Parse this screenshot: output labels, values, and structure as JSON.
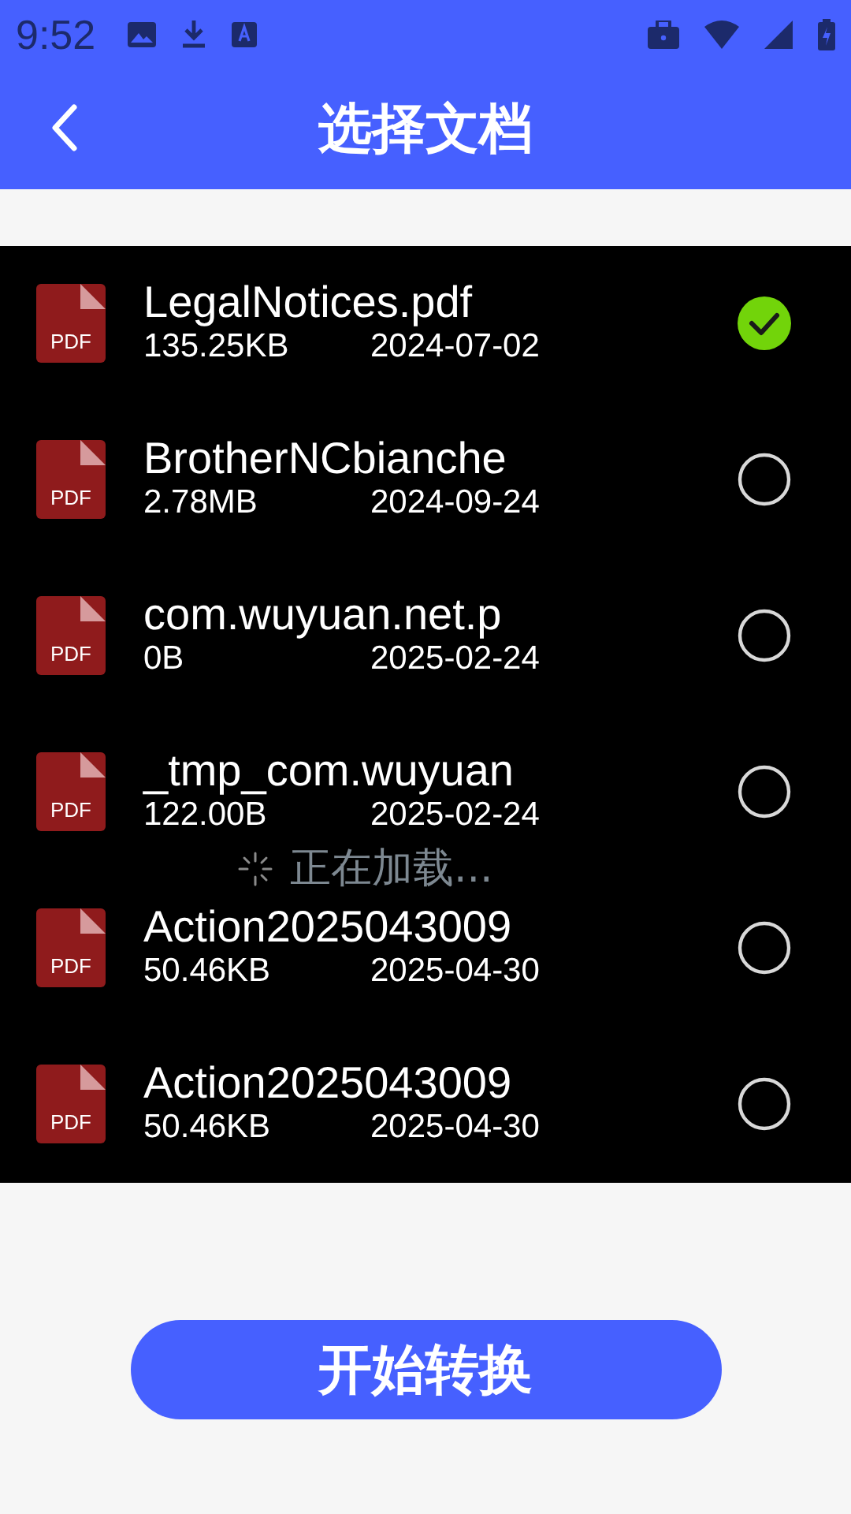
{
  "status_bar": {
    "time": "9:52"
  },
  "header": {
    "title": "选择文档"
  },
  "files": [
    {
      "name": "LegalNotices.pdf",
      "size": "135.25KB",
      "date": "2024-07-02",
      "type_label": "PDF",
      "selected": true
    },
    {
      "name": "BrotherNCbianche",
      "size": "2.78MB",
      "date": "2024-09-24",
      "type_label": "PDF",
      "selected": false
    },
    {
      "name": "com.wuyuan.net.p",
      "size": "0B",
      "date": "2025-02-24",
      "type_label": "PDF",
      "selected": false
    },
    {
      "name": "_tmp_com.wuyuan",
      "size": "122.00B",
      "date": "2025-02-24",
      "type_label": "PDF",
      "selected": false
    },
    {
      "name": "Action2025043009",
      "size": "50.46KB",
      "date": "2025-04-30",
      "type_label": "PDF",
      "selected": false
    },
    {
      "name": "Action2025043009",
      "size": "50.46KB",
      "date": "2025-04-30",
      "type_label": "PDF",
      "selected": false
    }
  ],
  "loading": {
    "text": "正在加载..."
  },
  "convert_button": {
    "label": "开始转换"
  }
}
